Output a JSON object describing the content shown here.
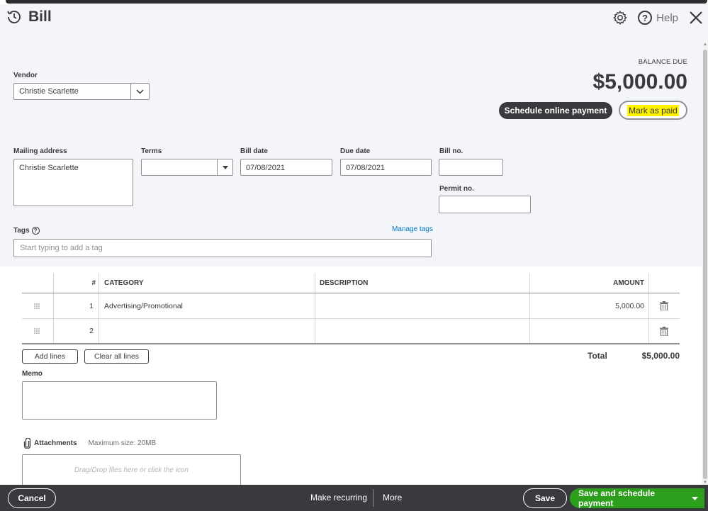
{
  "header": {
    "title": "Bill",
    "help_label": "Help"
  },
  "vendor": {
    "label": "Vendor",
    "value": "Christie Scarlette"
  },
  "balance": {
    "label": "BALANCE DUE",
    "amount": "$5,000.00"
  },
  "actions": {
    "schedule_online_payment": "Schedule online payment",
    "mark_as_paid": "Mark as paid"
  },
  "form": {
    "mailing_address_label": "Mailing address",
    "mailing_address_value": "Christie Scarlette",
    "terms_label": "Terms",
    "terms_value": "",
    "bill_date_label": "Bill date",
    "bill_date_value": "07/08/2021",
    "due_date_label": "Due date",
    "due_date_value": "07/08/2021",
    "bill_no_label": "Bill no.",
    "bill_no_value": "",
    "permit_no_label": "Permit no.",
    "permit_no_value": "",
    "tags_label": "Tags",
    "manage_tags": "Manage tags",
    "tags_placeholder": "Start typing to add a tag"
  },
  "table": {
    "headers": {
      "num": "#",
      "category": "CATEGORY",
      "description": "DESCRIPTION",
      "amount": "AMOUNT"
    },
    "rows": [
      {
        "num": "1",
        "category": "Advertising/Promotional",
        "description": "",
        "amount": "5,000.00"
      },
      {
        "num": "2",
        "category": "",
        "description": "",
        "amount": ""
      }
    ],
    "add_lines": "Add lines",
    "clear_all_lines": "Clear all lines",
    "total_label": "Total",
    "total_value": "$5,000.00"
  },
  "memo": {
    "label": "Memo",
    "value": ""
  },
  "attachments": {
    "label": "Attachments",
    "max_size": "Maximum size: 20MB",
    "drop_text": "Drag/Drop files here or click the icon"
  },
  "footer": {
    "cancel": "Cancel",
    "make_recurring": "Make recurring",
    "more": "More",
    "save": "Save",
    "save_and_schedule": "Save and schedule payment"
  },
  "colors": {
    "primary_green": "#2ca01c",
    "dark": "#393a3d",
    "link_blue": "#0077c5",
    "highlight": "#fff200"
  }
}
